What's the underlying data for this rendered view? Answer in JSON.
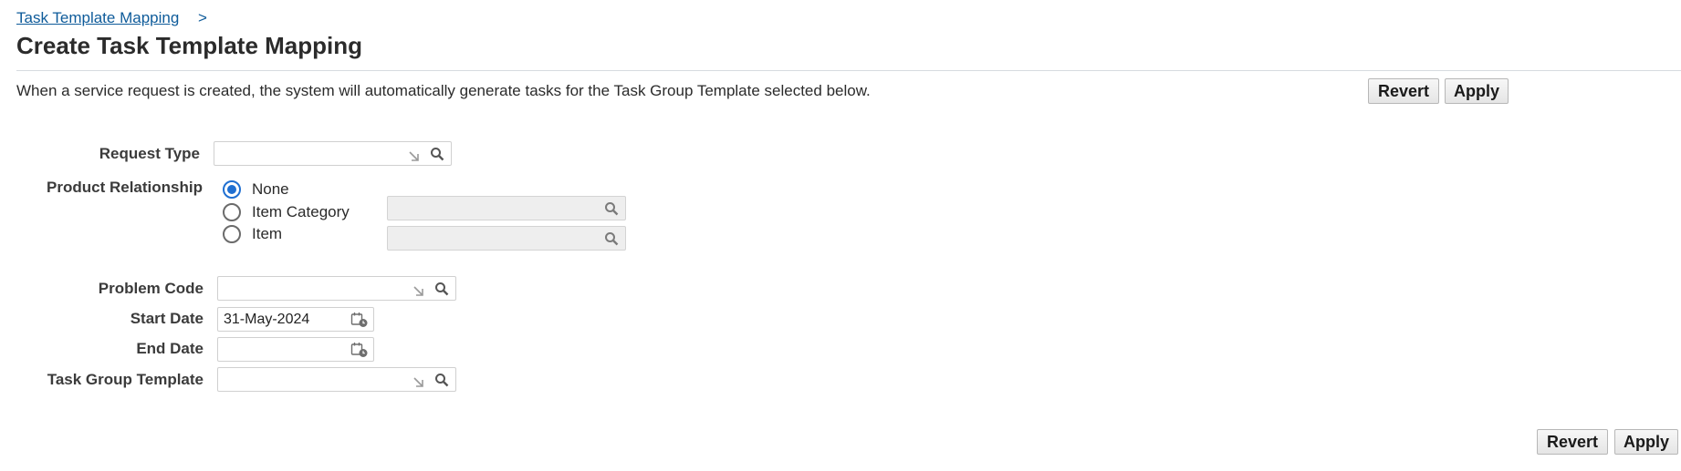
{
  "breadcrumb": {
    "link": "Task Template Mapping",
    "separator": ">"
  },
  "page_title": "Create Task Template Mapping",
  "instruction": "When a service request is created, the system will automatically generate tasks for the Task Group Template selected below.",
  "buttons": {
    "revert": "Revert",
    "apply": "Apply"
  },
  "form": {
    "request_type": {
      "label": "Request Type",
      "value": ""
    },
    "product_relationship": {
      "label": "Product Relationship",
      "options": [
        "None",
        "Item Category",
        "Item"
      ],
      "selected": "None"
    },
    "problem_code": {
      "label": "Problem Code",
      "value": ""
    },
    "start_date": {
      "label": "Start Date",
      "value": "31-May-2024"
    },
    "end_date": {
      "label": "End Date",
      "value": ""
    },
    "task_group_template": {
      "label": "Task Group Template",
      "value": ""
    }
  },
  "colors": {
    "link": "#0e5b9a",
    "radio_selected": "#1f6fd1"
  }
}
